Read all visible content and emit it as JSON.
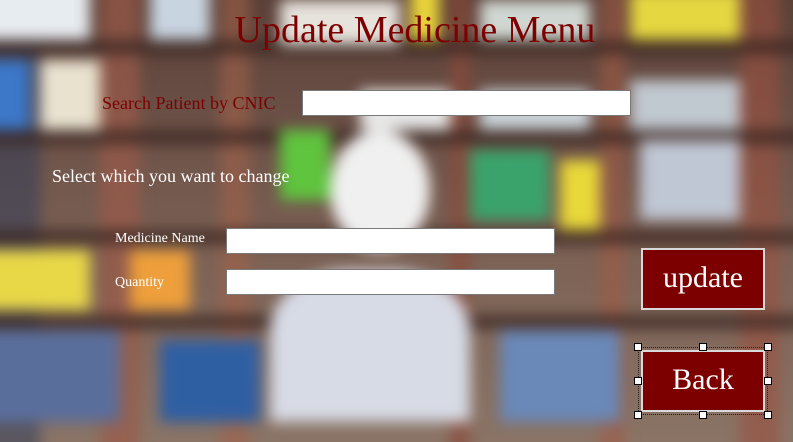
{
  "form": {
    "title": "Update Medicine Menu",
    "search_label": "Search Patient by CNIC",
    "search_value": "",
    "select_prompt": "Select which you want to change",
    "medicine_name_label": "Medicine Name",
    "medicine_name_value": "",
    "quantity_label": "Quantity",
    "quantity_value": "",
    "update_label": "update",
    "back_label": "Back"
  },
  "colors": {
    "title": "#7c0000",
    "button_bg": "#7d0000",
    "button_text": "#ffffff",
    "label_light": "#ffffff"
  },
  "icons": {
    "selection_handles": "resize-handle-icon"
  }
}
